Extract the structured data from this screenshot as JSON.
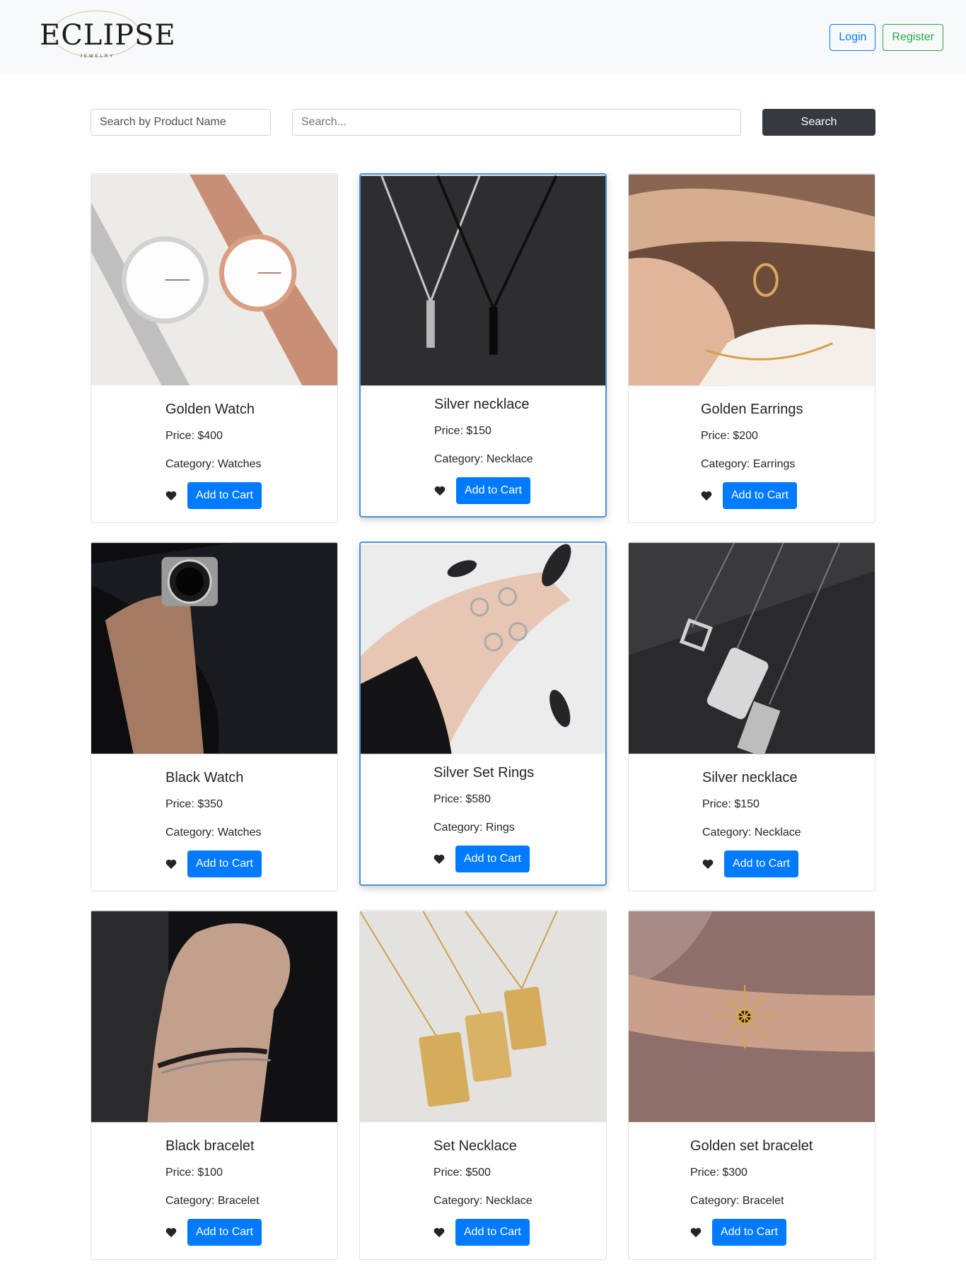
{
  "header": {
    "logo_text": "ECLIPSE",
    "logo_sub": "JEWELRY",
    "login_label": "Login",
    "register_label": "Register"
  },
  "search": {
    "filter_selected": "Search by Product Name",
    "placeholder": "Search...",
    "button_label": "Search"
  },
  "cart_label": "Add to Cart",
  "products": [
    {
      "name": "Golden Watch",
      "price": "Price: $400",
      "category": "Category: Watches"
    },
    {
      "name": "Silver necklace",
      "price": "Price: $150",
      "category": "Category: Necklace"
    },
    {
      "name": "Golden Earrings",
      "price": "Price: $200",
      "category": "Category: Earrings"
    },
    {
      "name": "Black Watch",
      "price": "Price: $350",
      "category": "Category: Watches"
    },
    {
      "name": "Silver Set Rings",
      "price": "Price: $580",
      "category": "Category: Rings"
    },
    {
      "name": "Silver necklace",
      "price": "Price: $150",
      "category": "Category: Necklace"
    },
    {
      "name": "Black bracelet",
      "price": "Price: $100",
      "category": "Category: Bracelet"
    },
    {
      "name": "Set Necklace",
      "price": "Price: $500",
      "category": "Category: Necklace"
    },
    {
      "name": "Golden set bracelet",
      "price": "Price: $300",
      "category": "Category: Bracelet"
    }
  ],
  "colors": {
    "primary": "#007bff",
    "success": "#28a745",
    "dark": "#343a40",
    "navbar_bg": "#f8f9fa"
  }
}
